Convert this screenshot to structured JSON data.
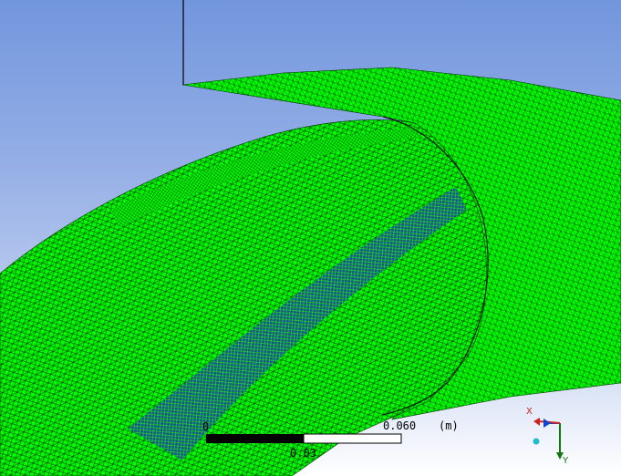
{
  "viewport": {
    "background_top": "#7296dd",
    "background_bottom": "#ffffff",
    "mesh_color": "#00ff00",
    "mesh_line_color": "#003300",
    "inner_face_color": "#1b3fa8"
  },
  "scale_bar": {
    "start_label": "0",
    "mid_label": "0.03",
    "end_label": "0.060",
    "unit_label": "(m)"
  },
  "axis_triad": {
    "x_label": "X",
    "y_label": "Y",
    "x_color": "#cc2222",
    "y_color": "#117711",
    "z_color": "#1144cc",
    "origin_color": "#22bbcc"
  }
}
